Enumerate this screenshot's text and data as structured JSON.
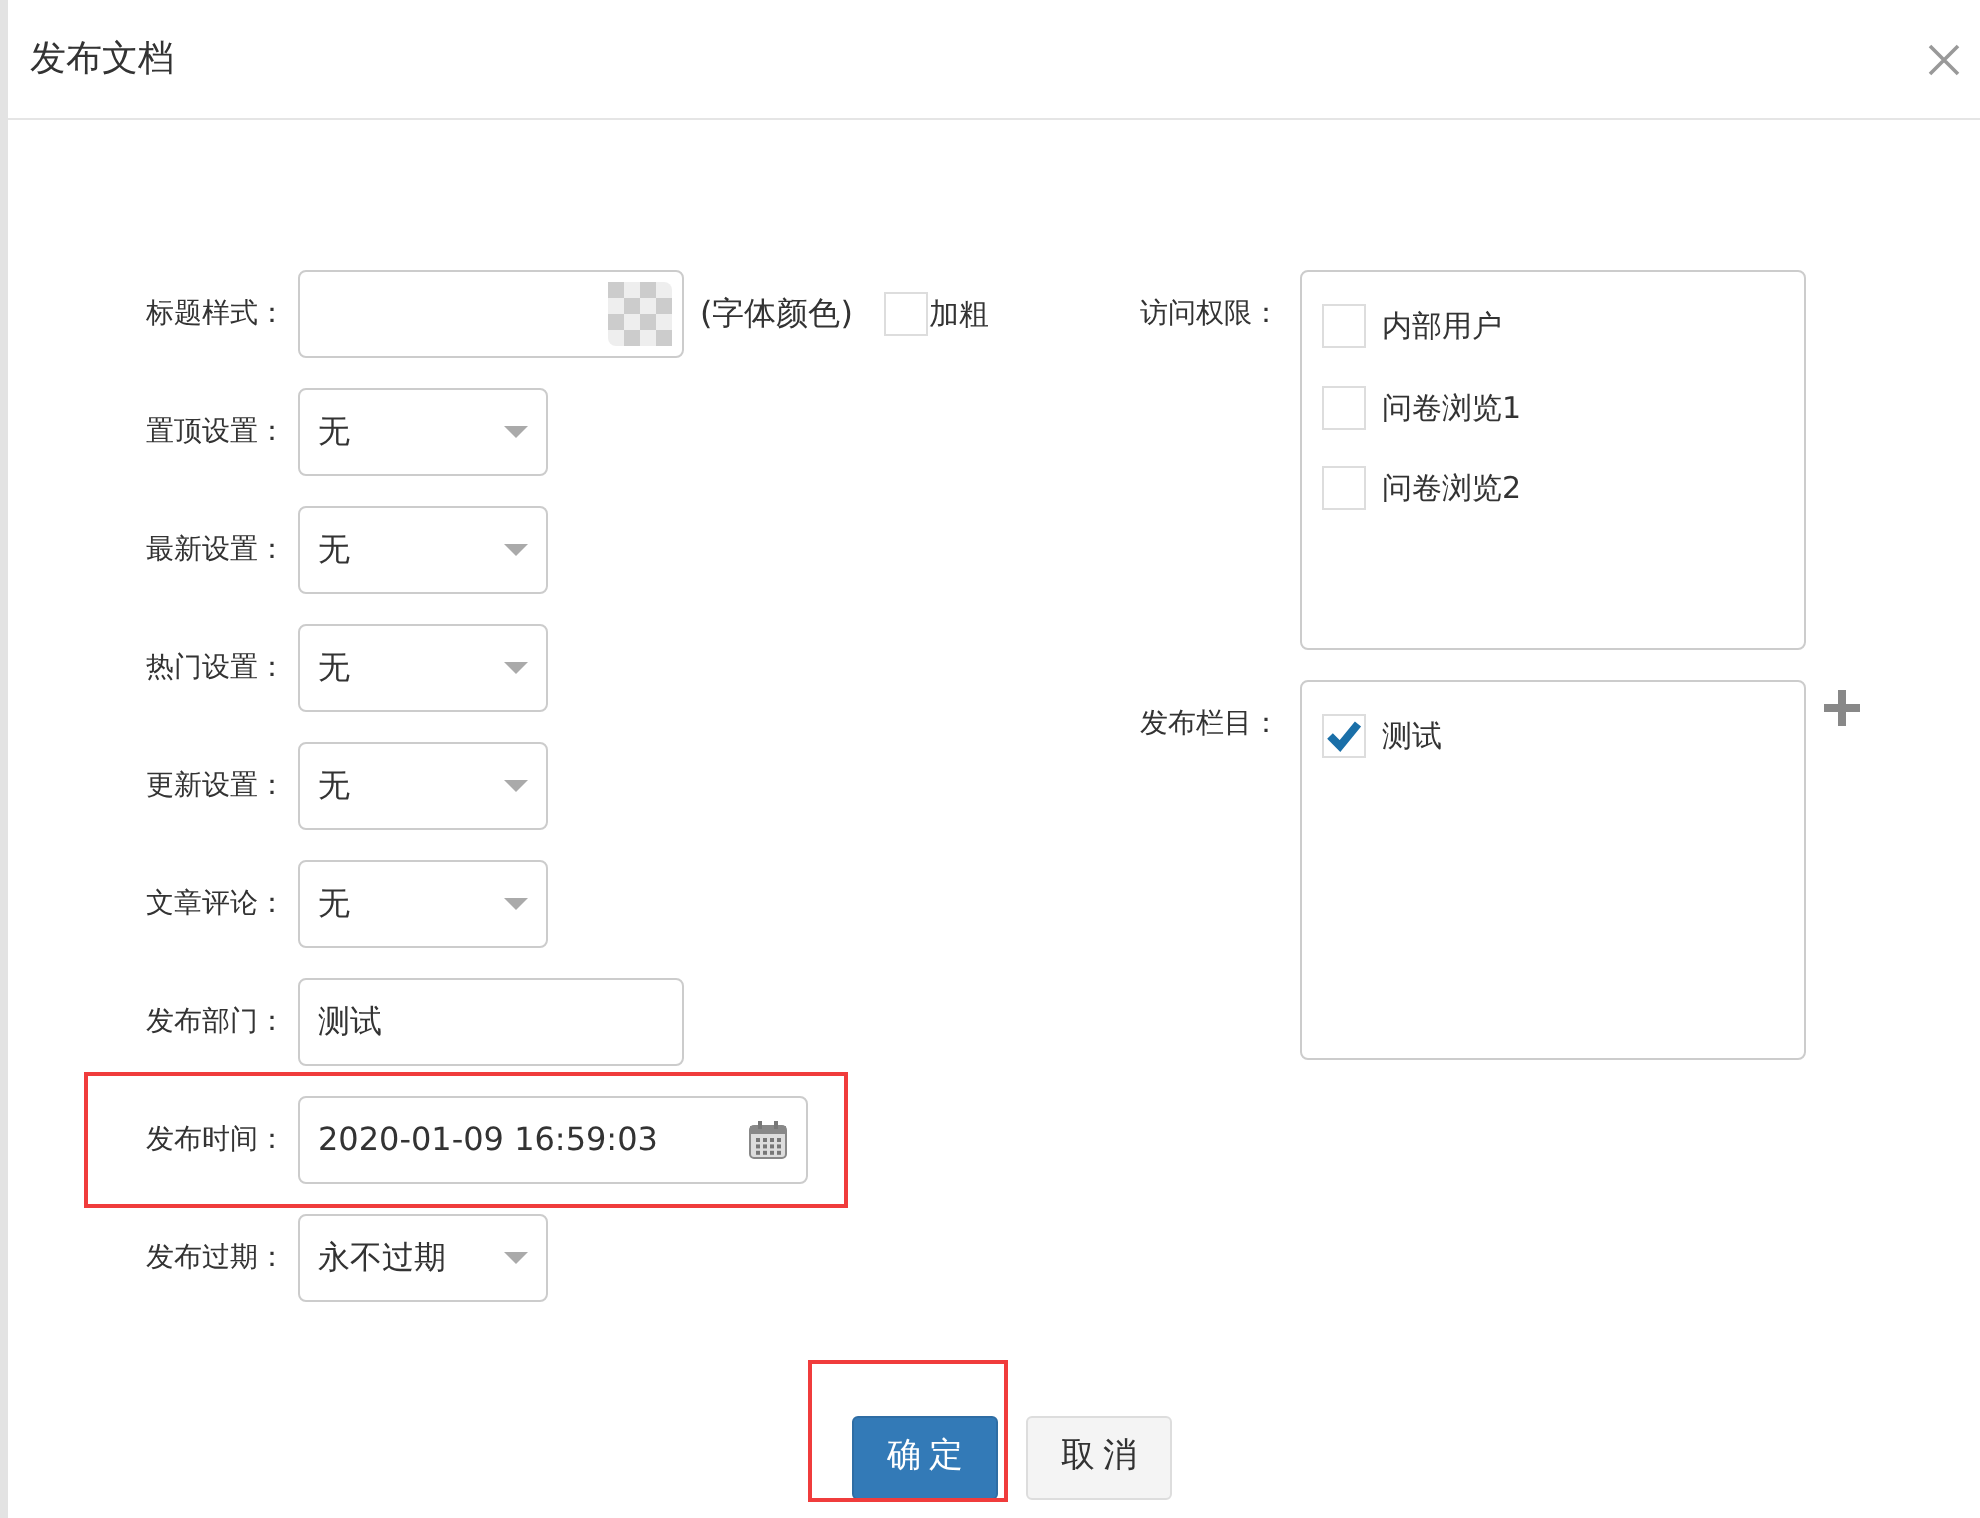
{
  "dialog": {
    "title": "发布文档"
  },
  "fields": [
    {
      "kind": "color_text",
      "label": "标题样式：",
      "hint": "(字体颜色)",
      "bold_option": {
        "label": "加粗",
        "checked": false
      },
      "highlighted": false
    },
    {
      "kind": "select",
      "label": "置顶设置：",
      "value": "无",
      "highlighted": false
    },
    {
      "kind": "select",
      "label": "最新设置：",
      "value": "无",
      "highlighted": false
    },
    {
      "kind": "select",
      "label": "热门设置：",
      "value": "无",
      "highlighted": false
    },
    {
      "kind": "select",
      "label": "更新设置：",
      "value": "无",
      "highlighted": false
    },
    {
      "kind": "select",
      "label": "文章评论：",
      "value": "无",
      "highlighted": false
    },
    {
      "kind": "text",
      "label": "发布部门：",
      "value": "测试",
      "highlighted": false
    },
    {
      "kind": "datetime",
      "label": "发布时间：",
      "value": "2020-01-09 16:59:03",
      "highlighted": true
    },
    {
      "kind": "select",
      "label": "发布过期：",
      "value": "永不过期",
      "highlighted": false
    }
  ],
  "access": {
    "label": "访问权限：",
    "options": [
      {
        "label": "内部用户",
        "checked": false
      },
      {
        "label": "问卷浏览1",
        "checked": false
      },
      {
        "label": "问卷浏览2",
        "checked": false
      }
    ]
  },
  "columns": {
    "label": "发布栏目：",
    "options": [
      {
        "label": "测试",
        "checked": true
      }
    ]
  },
  "buttons": [
    {
      "label": "确定",
      "kind": "primary",
      "highlighted": true
    },
    {
      "label": "取消",
      "kind": "default",
      "highlighted": false
    }
  ]
}
